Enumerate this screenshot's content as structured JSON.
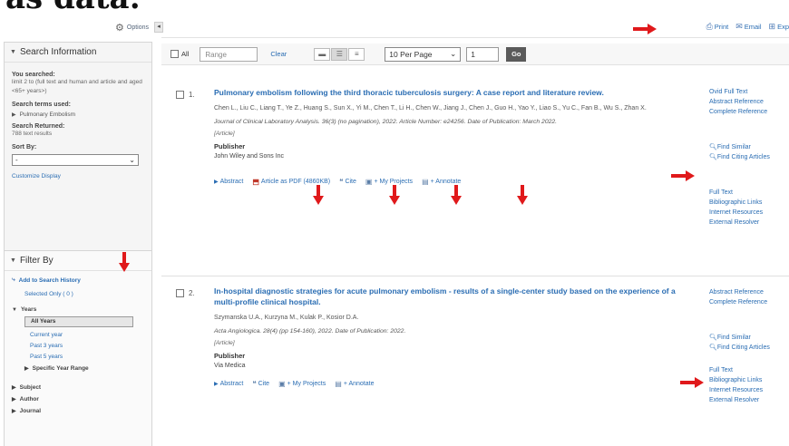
{
  "heading_fragment": "as data:",
  "options": {
    "label": "Options",
    "collapse": "◂"
  },
  "search_info": {
    "title": "Search Information",
    "you_searched_label": "You searched:",
    "you_searched_text": "limit 2 to (full text and human and article and aged <65+ years>)",
    "terms_label": "Search terms used:",
    "term": "Pulmonary Embolism",
    "returned_label": "Search Returned:",
    "returned_text": "788 text results",
    "sort_label": "Sort By:",
    "sort_value": "-",
    "customize": "Customize Display"
  },
  "filter": {
    "title": "Filter By",
    "add_history": "Add to Search History",
    "selected_only": "Selected Only ( 0 )",
    "years_label": "Years",
    "years": [
      "All Years",
      "Current year",
      "Past 3 years",
      "Past 5 years"
    ],
    "specific_range": "Specific Year Range",
    "facets": [
      "Subject",
      "Author",
      "Journal"
    ]
  },
  "top_actions": {
    "print": "Print",
    "email": "Email",
    "export": "Exp"
  },
  "toolbar": {
    "all_label": "All",
    "range_placeholder": "Range",
    "clear": "Clear",
    "per_page": "10 Per Page",
    "page": "1",
    "go": "Go"
  },
  "records": [
    {
      "num": "1.",
      "title": "Pulmonary embolism following the third thoracic tuberculosis surgery: A case report and literature review.",
      "authors": "Chen L., Liu C., Liang T., Ye Z., Huang S., Sun X., Yi M., Chen T., Li H., Chen W., Jiang J., Chen J., Guo H., Yao Y., Liao S., Yu C., Fan B., Wu S., Zhan X.",
      "source": "Journal of Clinical Laboratory Analysis. 36(3) (no pagination), 2022. Article Number: e24256. Date of Publication: March 2022.",
      "type": "[Article]",
      "publisher_label": "Publisher",
      "publisher": "John Wiley and Sons Inc",
      "actions": {
        "abstract": "Abstract",
        "pdf": "Article as PDF (4860KB)",
        "cite": "Cite",
        "projects": "+ My Projects",
        "annotate": "+ Annotate"
      },
      "links_top": [
        "Ovid Full Text",
        "Abstract Reference",
        "Complete Reference"
      ],
      "links_mid": [
        "Find Similar",
        "Find Citing Articles"
      ],
      "links_bottom": [
        "Full Text",
        "Bibliographic Links",
        "Internet Resources",
        "External Resolver"
      ]
    },
    {
      "num": "2.",
      "title": "In-hospital diagnostic strategies for acute pulmonary embolism - results of a single-center study based on the experience of a multi-profile clinical hospital.",
      "authors": "Szymanska U.A., Kurzyna M., Kulak P., Kosior D.A.",
      "source": "Acta Angiologica. 28(4) (pp 154-160), 2022. Date of Publication: 2022.",
      "type": "[Article]",
      "publisher_label": "Publisher",
      "publisher": "Via Medica",
      "actions": {
        "abstract": "Abstract",
        "cite": "Cite",
        "projects": "+ My Projects",
        "annotate": "+ Annotate"
      },
      "links_top": [
        "Abstract Reference",
        "Complete Reference"
      ],
      "links_mid": [
        "Find Similar",
        "Find Citing Articles"
      ],
      "links_bottom": [
        "Full Text",
        "Bibliographic Links",
        "Internet Resources",
        "External Resolver"
      ]
    }
  ],
  "colors": {
    "link": "#2a6db3",
    "annotation_arrow": "#e0191b"
  }
}
